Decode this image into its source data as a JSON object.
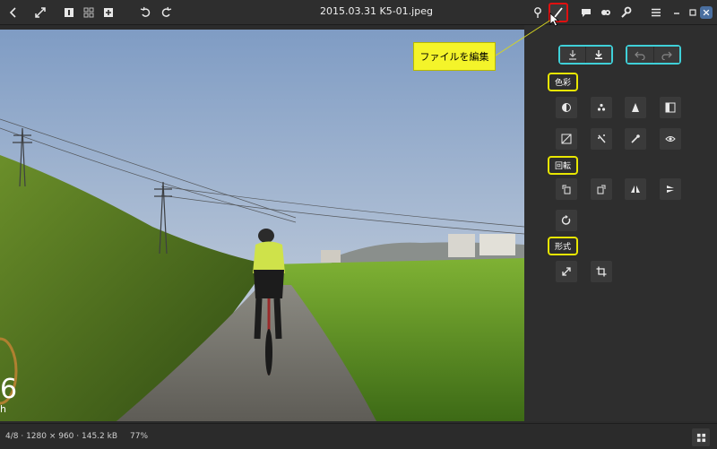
{
  "window": {
    "title": "2015.03.31 K5-01.jpeg"
  },
  "toolbar": {
    "icons": [
      "back-icon",
      "fullscreen-icon",
      "single-view-icon",
      "grid-view-icon",
      "add-icon",
      "undo-icon",
      "redo-icon",
      "location-icon",
      "edit-icon",
      "comment-icon",
      "tags-icon",
      "tools-icon",
      "menu-icon",
      "minimize-icon",
      "maximize-icon",
      "close-icon"
    ]
  },
  "callout": {
    "text": "ファイルを編集"
  },
  "panel": {
    "sections": {
      "color": "色彩",
      "rotate": "回転",
      "format": "形式"
    }
  },
  "overlay": {
    "speed_value": "6",
    "speed_unit": "h"
  },
  "status": {
    "info": "4/8 · 1280 × 960 · 145.2 kB",
    "zoom": "77%"
  },
  "colors": {
    "callout": "#f4f42a",
    "highlight_cyan": "#3fd0d8",
    "highlight_yellow": "#e8e600",
    "edit_highlight": "#e01010",
    "close_button": "#4a6fa0"
  }
}
